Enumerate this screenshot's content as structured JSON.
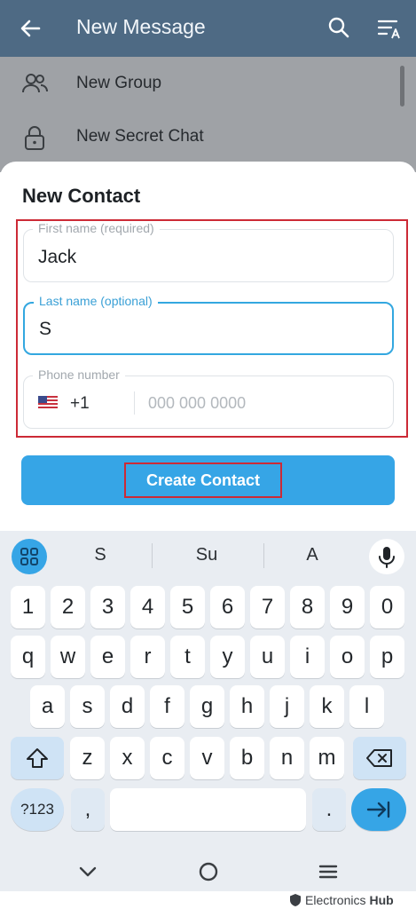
{
  "appbar": {
    "title": "New Message",
    "back_icon": "arrow-left-icon",
    "search_icon": "search-icon",
    "sort_icon": "sort-alpha-icon",
    "color": "#4e6a84"
  },
  "list": {
    "items": [
      {
        "label": "New Group",
        "icon": "group-icon"
      },
      {
        "label": "New Secret Chat",
        "icon": "lock-icon"
      }
    ]
  },
  "sheet": {
    "title": "New Contact",
    "first_name": {
      "label": "First name (required)",
      "value": "Jack"
    },
    "last_name": {
      "label": "Last name (optional)",
      "value": "S"
    },
    "phone": {
      "label": "Phone number",
      "country_code": "+1",
      "placeholder": "000 000 0000",
      "flag_icon": "us-flag-icon"
    },
    "create_button": "Create Contact",
    "accent": "#36a5e6",
    "highlight": "#cc2a36"
  },
  "keyboard": {
    "suggestions": [
      "S",
      "Su",
      "A"
    ],
    "row1": [
      "1",
      "2",
      "3",
      "4",
      "5",
      "6",
      "7",
      "8",
      "9",
      "0"
    ],
    "row2": [
      "q",
      "w",
      "e",
      "r",
      "t",
      "y",
      "u",
      "i",
      "o",
      "p"
    ],
    "row3": [
      "a",
      "s",
      "d",
      "f",
      "g",
      "h",
      "j",
      "k",
      "l"
    ],
    "row4": [
      "z",
      "x",
      "c",
      "v",
      "b",
      "n",
      "m"
    ],
    "symbols_key": "?123",
    "comma_key": ",",
    "period_key": "."
  },
  "watermark": {
    "text": "Electronics",
    "bold": "Hub"
  }
}
